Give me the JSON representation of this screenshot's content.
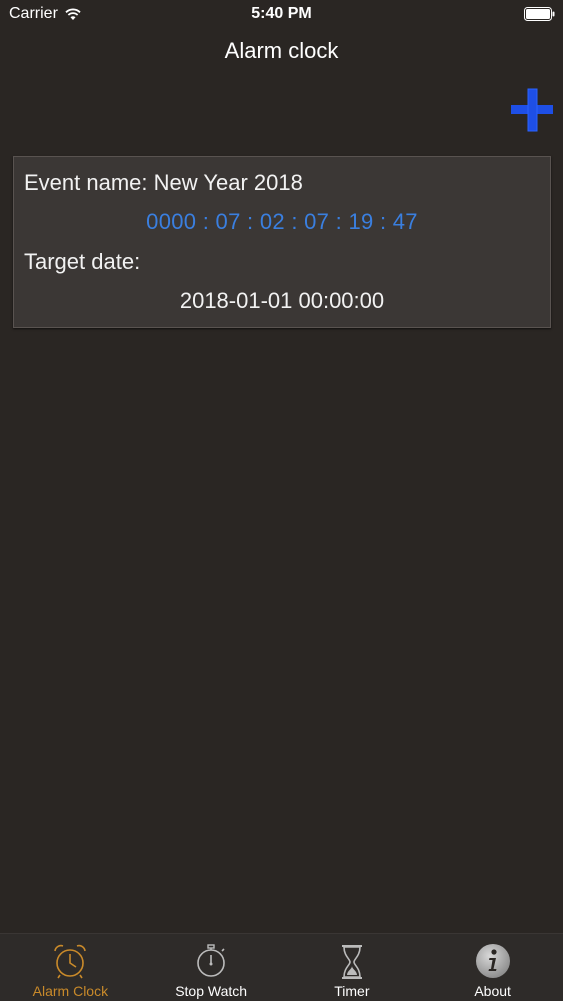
{
  "status_bar": {
    "carrier": "Carrier",
    "time": "5:40 PM"
  },
  "nav": {
    "title": "Alarm clock"
  },
  "event": {
    "name_text": "Event name: New Year 2018",
    "countdown": "0000 : 07 : 02 : 07 : 19 : 47",
    "target_label": "Target date:",
    "target_value": "2018-01-01 00:00:00"
  },
  "tabs": [
    {
      "label": "Alarm Clock",
      "icon": "alarm-clock-icon",
      "active": true
    },
    {
      "label": "Stop Watch",
      "icon": "stopwatch-icon",
      "active": false
    },
    {
      "label": "Timer",
      "icon": "hourglass-icon",
      "active": false
    },
    {
      "label": "About",
      "icon": "info-icon",
      "active": false
    }
  ],
  "colors": {
    "background": "#2a2623",
    "card": "#3b3735",
    "countdown": "#3a7fe0",
    "add_button": "#1e4fe6",
    "active_tab": "#c98a2a"
  }
}
